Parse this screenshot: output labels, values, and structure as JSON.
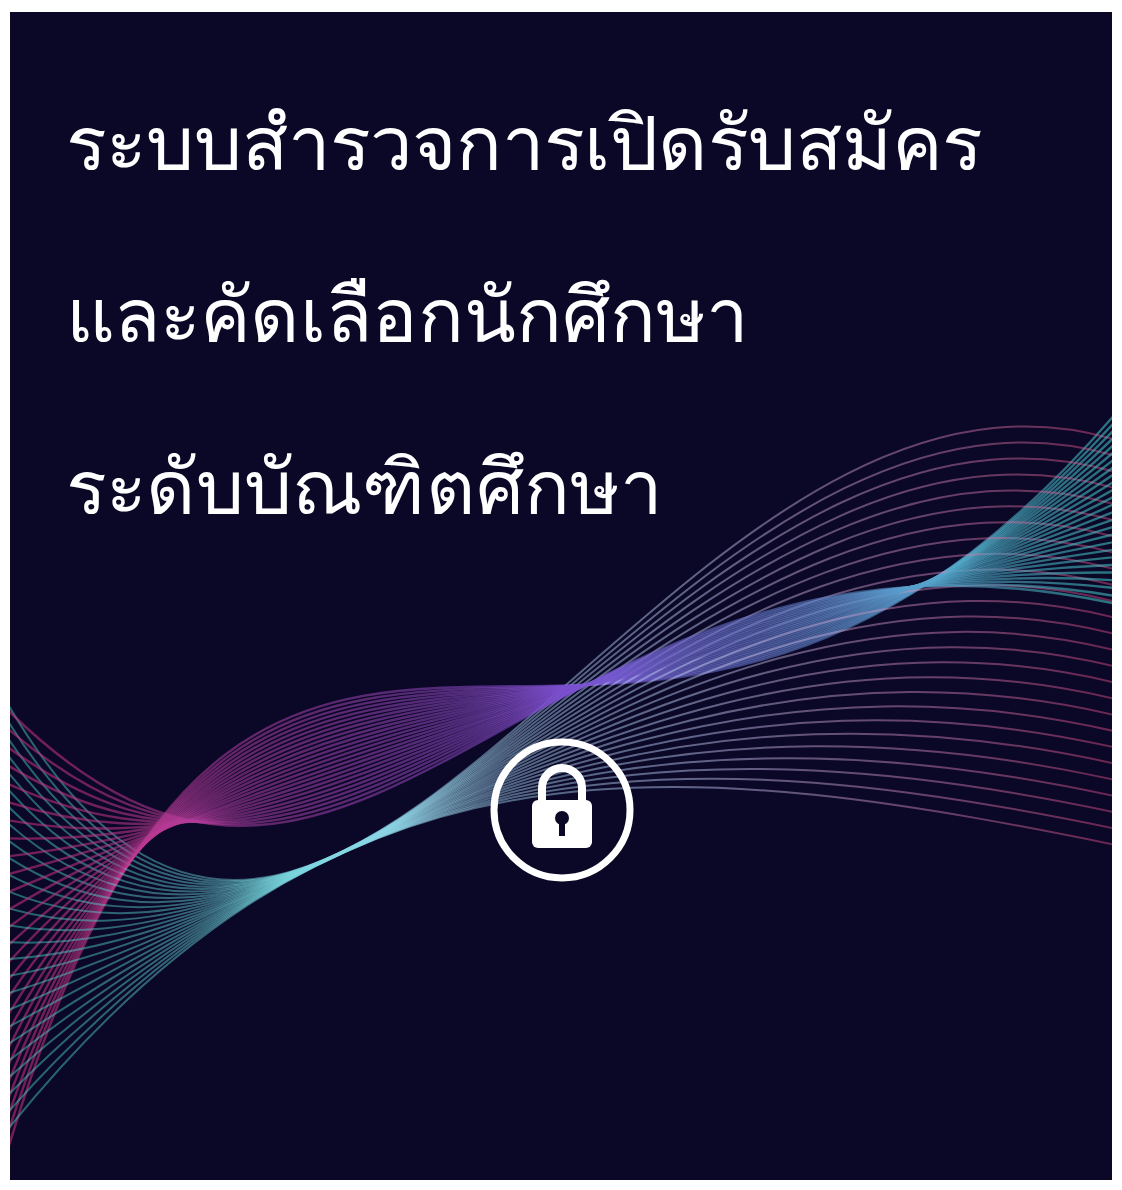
{
  "banner": {
    "title_lines": [
      "ระบบสำรวจการเปิดรับสมัคร",
      "และคัดเลือกนักศึกษา",
      "ระดับบัณฑิตศึกษา"
    ]
  }
}
